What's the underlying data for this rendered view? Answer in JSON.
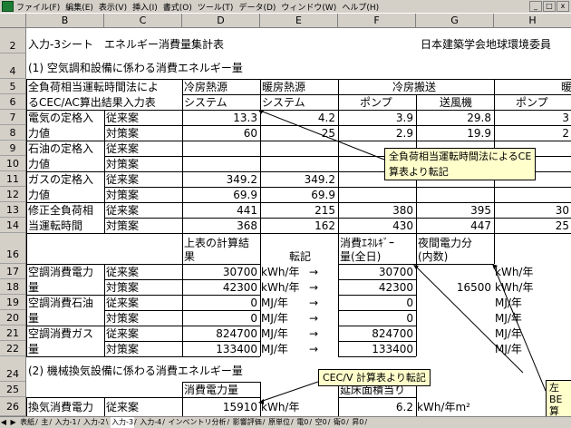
{
  "menu": [
    "ファイル(F)",
    "編集(E)",
    "表示(V)",
    "挿入(I)",
    "書式(O)",
    "ツール(T)",
    "データ(D)",
    "ウィンドウ(W)",
    "ヘルプ(H)"
  ],
  "window_buttons": [
    "_",
    "□",
    "x"
  ],
  "columns": [
    "B",
    "C",
    "D",
    "E",
    "F",
    "G",
    "H"
  ],
  "rows": [
    "2",
    "4",
    "5",
    "6",
    "7",
    "8",
    "9",
    "10",
    "11",
    "12",
    "13",
    "14",
    "16",
    "17",
    "18",
    "19",
    "20",
    "21",
    "22",
    "24",
    "25",
    "26"
  ],
  "sheet": {
    "title": "入力-3シート　エネルギー消費量集計表",
    "org": "日本建築学会地球環境委員",
    "sec1": "(1) 空気調和設備に係わる消費エネルギー量",
    "hdr5_b": "全負荷相当運転時間法によ",
    "hdr6_b": "るCEC/AC算出結果入力表",
    "hdr5_d": "冷房熱源",
    "hdr6_d": "システム",
    "hdr5_e": "暖房熱源",
    "hdr6_e": "システム",
    "hdr5_fg": "冷房搬送",
    "hdr5_h": "暖",
    "hdr6_f": "ポンプ",
    "hdr6_g": "送風機",
    "hdr6_h": "ポンプ",
    "elec_1": "電気の定格入",
    "elec_2": "力値",
    "oil_1": "石油の定格入",
    "oil_2": "力値",
    "gas_1": "ガスの定格入",
    "gas_2": "力値",
    "corr_1": "修正全負荷相",
    "corr_2": "当運転時間",
    "jurai": "従来案",
    "taisaku": "対策案",
    "r7": [
      "13.3",
      "4.2",
      "3.9",
      "29.8",
      "3"
    ],
    "r8": [
      "60",
      "25",
      "2.9",
      "19.9",
      "2"
    ],
    "r11": [
      "349.2",
      "349.2"
    ],
    "r12": [
      "69.9",
      "69.9"
    ],
    "r13": [
      "441",
      "215",
      "380",
      "395",
      "30"
    ],
    "r14": [
      "368",
      "162",
      "430",
      "447",
      "25"
    ],
    "hdr16_d1": "上表の計算結",
    "hdr16_d2": "果",
    "hdr16_e": "転記",
    "hdr16_f1": "消費ｴﾈﾙｷﾞｰ",
    "hdr16_f2": "量(全日)",
    "hdr16_g1": "夜間電力分",
    "hdr16_g2": "(内数)",
    "ac_elec_1": "空調消費電力",
    "ac_elec_2": "量",
    "ac_oil_1": "空調消費石油",
    "ac_oil_2": "量",
    "ac_gas_1": "空調消費ガス",
    "ac_gas_2": "量",
    "unit_kwh": "kWh/年",
    "unit_mj": "MJ/年",
    "arrow": "→",
    "r17": [
      "30700",
      "30700"
    ],
    "r18": [
      "42300",
      "42300",
      "16500"
    ],
    "r19": [
      "0",
      "0"
    ],
    "r20": [
      "0",
      "0"
    ],
    "r21": [
      "824700",
      "824700"
    ],
    "r22": [
      "133400",
      "133400"
    ],
    "sec2": "(2) 機械換気設備に係わる消費エネルギー量",
    "hdr25_d": "消費電力量",
    "hdr25_f": "延床面積当り",
    "vent_1": "換気消費電力",
    "r26_d": "15910",
    "r26_e": "kWh/年",
    "r26_f": "6.2",
    "r26_g": "kWh/年m²"
  },
  "callouts": {
    "c1_line1": "全負荷相当運転時間法によるCE",
    "c1_line2": "算表より転記",
    "c2": "CEC/V 計算表より転記",
    "c3_line1": "左",
    "c3_line2": "BE",
    "c3_line3": "算"
  },
  "tabs": [
    "表紙",
    "主",
    "入力-1",
    "入力-2",
    "入力-3",
    "入力-4",
    "インベントリ分析",
    "影響評価",
    "原単位",
    "電0",
    "空0",
    "衛0",
    "昇0"
  ],
  "active_tab": "入力-3",
  "tab_nav": [
    "◀",
    "▶"
  ]
}
